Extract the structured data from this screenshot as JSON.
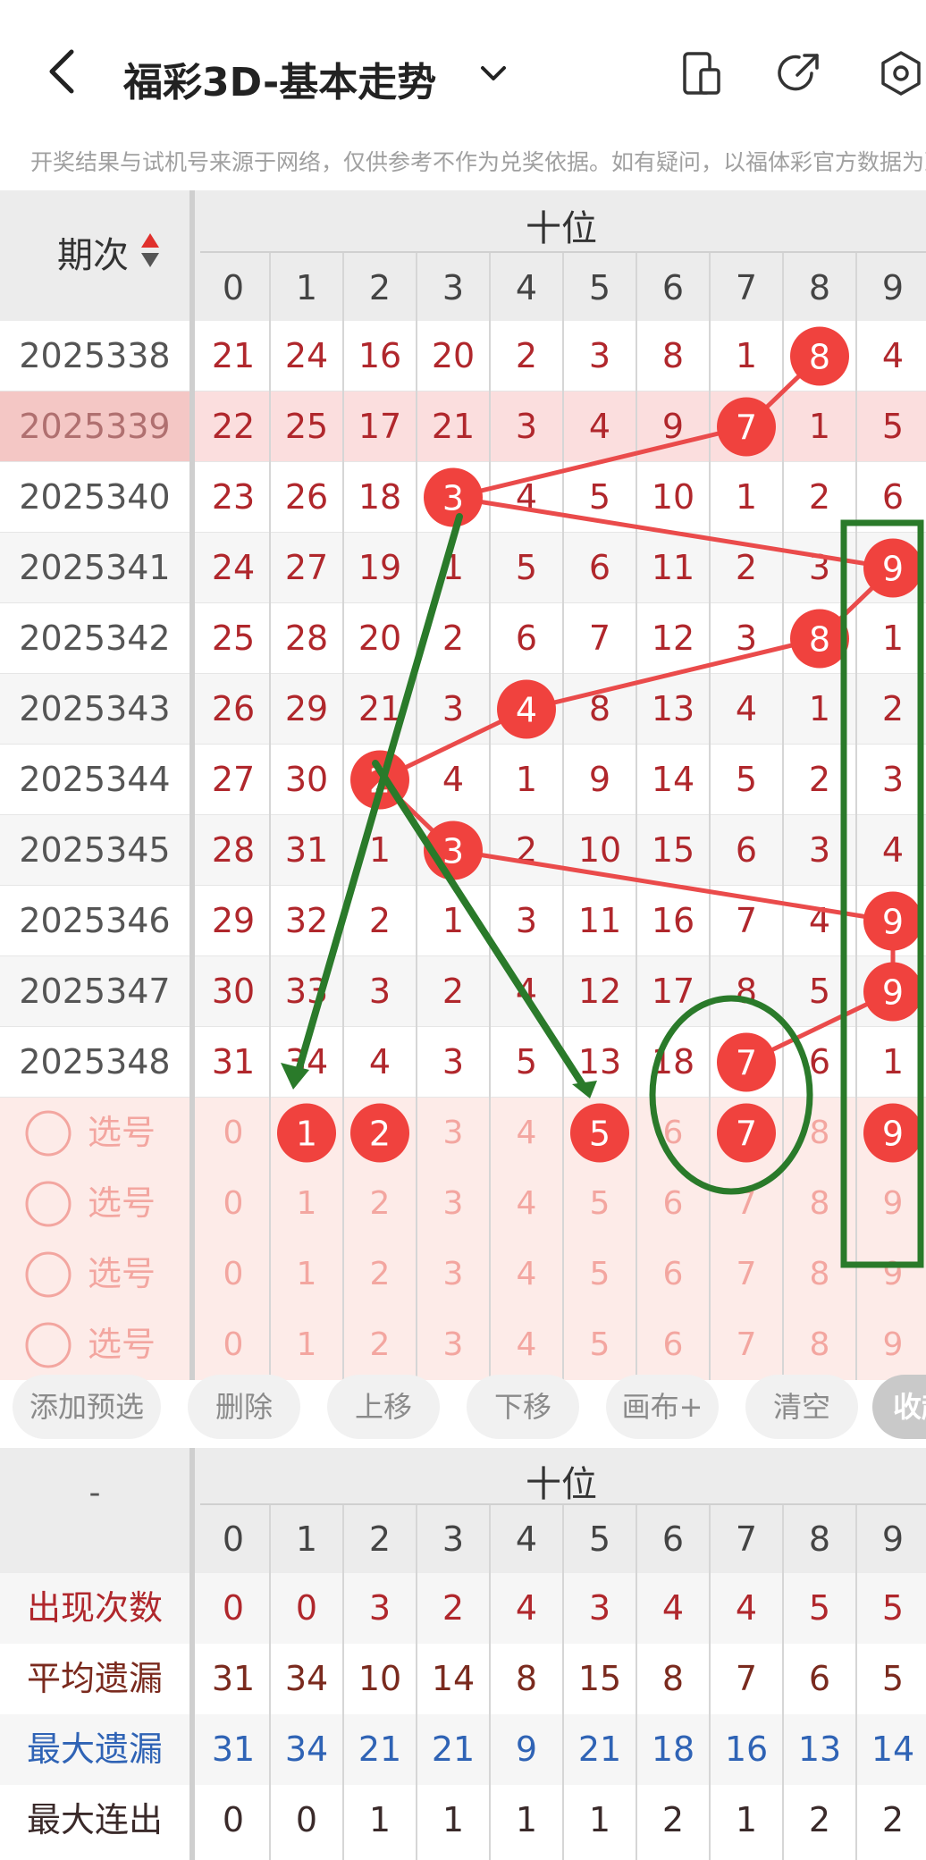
{
  "header": {
    "title": "福彩3D-基本走势"
  },
  "notice": "开奖结果与试机号来源于网络，仅供参考不作为兑奖依据。如有疑问，以福体彩官方数据为准。",
  "grid": {
    "period_header": "期次",
    "position_label": "十位",
    "digits": [
      "0",
      "1",
      "2",
      "3",
      "4",
      "5",
      "6",
      "7",
      "8",
      "9"
    ],
    "rows": [
      {
        "period": "2025338",
        "cells": [
          "21",
          "24",
          "16",
          "20",
          "2",
          "3",
          "8",
          "1",
          "8",
          "4"
        ],
        "hit": 8
      },
      {
        "period": "2025339",
        "cells": [
          "22",
          "25",
          "17",
          "21",
          "3",
          "4",
          "9",
          "7",
          "1",
          "5"
        ],
        "hit": 7
      },
      {
        "period": "2025340",
        "cells": [
          "23",
          "26",
          "18",
          "3",
          "4",
          "5",
          "10",
          "1",
          "2",
          "6"
        ],
        "hit": 3
      },
      {
        "period": "2025341",
        "cells": [
          "24",
          "27",
          "19",
          "1",
          "5",
          "6",
          "11",
          "2",
          "3",
          "9"
        ],
        "hit": 9
      },
      {
        "period": "2025342",
        "cells": [
          "25",
          "28",
          "20",
          "2",
          "6",
          "7",
          "12",
          "3",
          "8",
          "1"
        ],
        "hit": 8
      },
      {
        "period": "2025343",
        "cells": [
          "26",
          "29",
          "21",
          "3",
          "4",
          "8",
          "13",
          "4",
          "1",
          "2"
        ],
        "hit": 4
      },
      {
        "period": "2025344",
        "cells": [
          "27",
          "30",
          "2",
          "4",
          "1",
          "9",
          "14",
          "5",
          "2",
          "3"
        ],
        "hit": 2
      },
      {
        "period": "2025345",
        "cells": [
          "28",
          "31",
          "1",
          "3",
          "2",
          "10",
          "15",
          "6",
          "3",
          "4"
        ],
        "hit": 3
      },
      {
        "period": "2025346",
        "cells": [
          "29",
          "32",
          "2",
          "1",
          "3",
          "11",
          "16",
          "7",
          "4",
          "9"
        ],
        "hit": 9
      },
      {
        "period": "2025347",
        "cells": [
          "30",
          "33",
          "3",
          "2",
          "4",
          "12",
          "17",
          "8",
          "5",
          "9"
        ],
        "hit": 9
      },
      {
        "period": "2025348",
        "cells": [
          "31",
          "34",
          "4",
          "3",
          "5",
          "13",
          "18",
          "7",
          "6",
          "1"
        ],
        "hit": 7
      }
    ],
    "select_label": "选号",
    "select_rows": [
      {
        "selected": [
          1,
          2,
          5,
          7,
          9
        ]
      },
      {
        "selected": []
      },
      {
        "selected": []
      },
      {
        "selected": []
      }
    ]
  },
  "toolbar": {
    "buttons": [
      "添加预选",
      "删除",
      "上移",
      "下移",
      "画布+",
      "清空",
      "收起"
    ]
  },
  "stats": {
    "corner": "-",
    "position_label": "十位",
    "rows": [
      {
        "label": "出现次数",
        "values": [
          "0",
          "0",
          "3",
          "2",
          "4",
          "3",
          "4",
          "4",
          "5",
          "5"
        ],
        "color": "#b0272c"
      },
      {
        "label": "平均遗漏",
        "values": [
          "31",
          "34",
          "10",
          "14",
          "8",
          "15",
          "8",
          "7",
          "6",
          "5"
        ],
        "color": "#7a2a1e"
      },
      {
        "label": "最大遗漏",
        "values": [
          "31",
          "34",
          "21",
          "21",
          "9",
          "21",
          "18",
          "16",
          "13",
          "14"
        ],
        "color": "#2f63b5"
      },
      {
        "label": "最大连出",
        "values": [
          "0",
          "0",
          "1",
          "1",
          "1",
          "1",
          "2",
          "1",
          "2",
          "2"
        ],
        "color": "#3a2a2a"
      }
    ]
  },
  "colors": {
    "hit_ball": "#f0423e",
    "trend_line": "#ea4b4b",
    "annotation": "#2a7a2a",
    "cell_text": "#b0272c",
    "select_bg": "#fdebe8",
    "select_text": "#f3a6a0"
  }
}
